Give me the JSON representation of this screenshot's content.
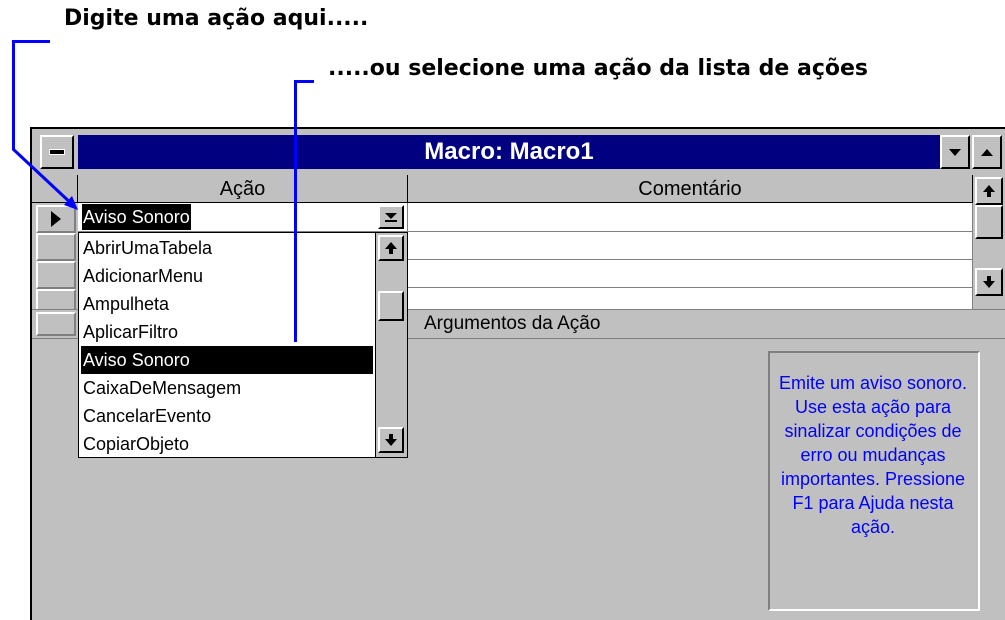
{
  "callouts": {
    "type_here": "Digite uma ação aqui.....",
    "select_here": ".....ou selecione uma ação da lista de ações"
  },
  "window": {
    "title": "Macro: Macro1",
    "accent_color": "#000080"
  },
  "grid": {
    "col_action": "Ação",
    "col_comment": "Comentário",
    "current_action": "Aviso Sonoro"
  },
  "dropdown": {
    "items": [
      "AbrirUmaTabela",
      "AdicionarMenu",
      "Ampulheta",
      "AplicarFiltro",
      "Aviso Sonoro",
      "CaixaDeMensagem",
      "CancelarEvento",
      "CopiarObjeto"
    ],
    "selected": "Aviso Sonoro"
  },
  "arguments": {
    "label": "Argumentos da Ação",
    "help_text": "Emite um aviso sonoro. Use esta ação para sinalizar condições de erro ou mudanças importantes. Pressione F1 para Ajuda nesta ação.",
    "help_color": "#0000ff"
  }
}
